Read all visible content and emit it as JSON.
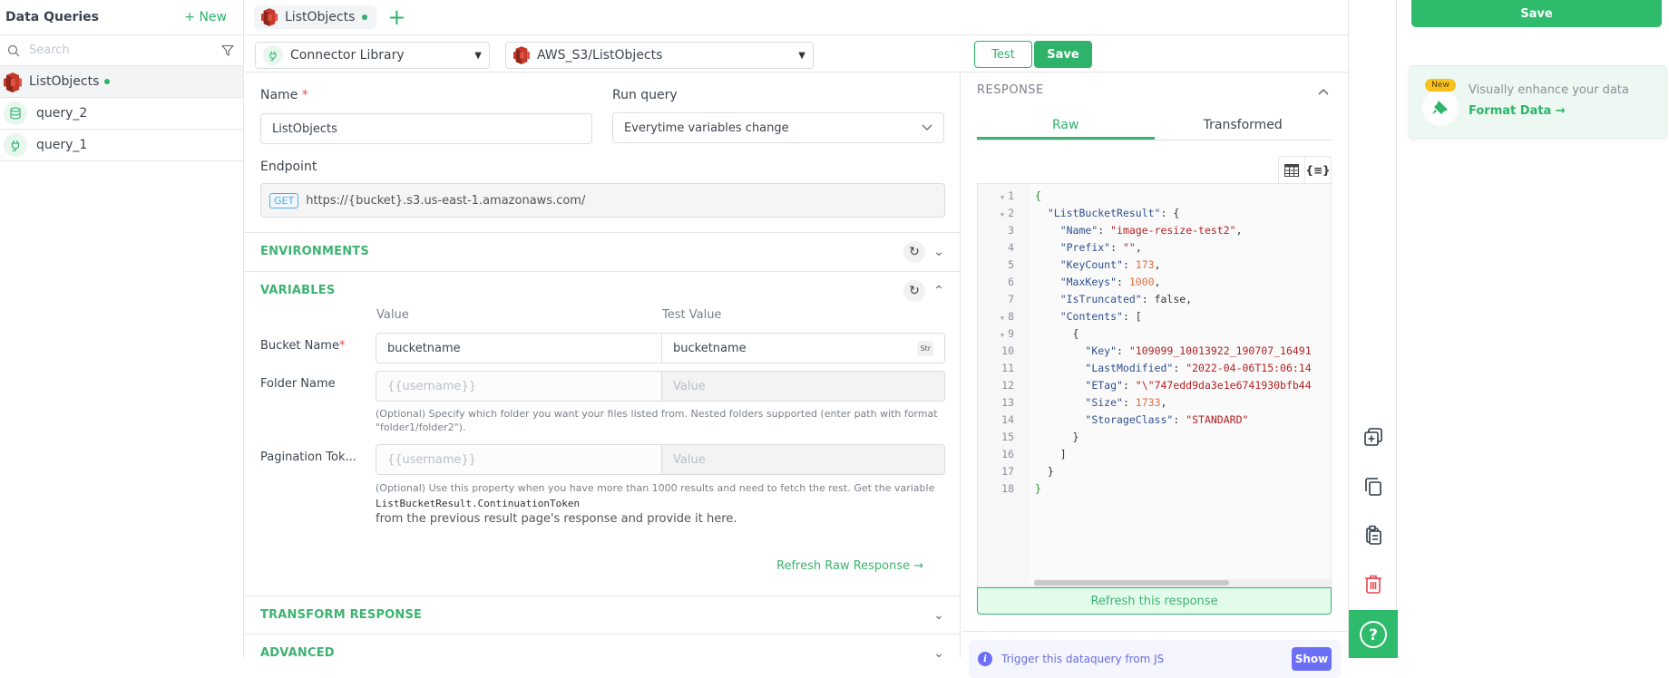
{
  "sidebar": {
    "title": "Data Queries",
    "new_label": "+ New",
    "search_placeholder": "Search",
    "items": [
      {
        "label": "ListObjects",
        "icon": "aws-s3-icon",
        "active": true,
        "unsaved": true
      },
      {
        "label": "query_2",
        "icon": "database-icon",
        "active": false
      },
      {
        "label": "query_1",
        "icon": "plug-icon",
        "active": false
      }
    ]
  },
  "topbar": {
    "tab_label": "ListObjects",
    "add_tab": "+"
  },
  "toolbar": {
    "datasource": "Connector Library",
    "operation": "AWS_S3/ListObjects",
    "test_label": "Test",
    "save_label": "Save"
  },
  "editor": {
    "name_label": "Name",
    "name_required": "*",
    "name_value": "ListObjects",
    "run_query_label": "Run query",
    "run_query_value": "Everytime variables change",
    "endpoint_label": "Endpoint",
    "endpoint_method": "GET",
    "endpoint_url": "https://{bucket}.s3.us-east-1.amazonaws.com/",
    "sections": {
      "environments": "ENVIRONMENTS",
      "variables": "VARIABLES",
      "transform": "TRANSFORM RESPONSE",
      "advanced": "ADVANCED"
    },
    "variables": {
      "col_value": "Value",
      "col_test_value": "Test Value",
      "rows": [
        {
          "label": "Bucket Name",
          "required": "*",
          "value": "bucketname",
          "test_value": "bucketname",
          "type_badge": "Str"
        },
        {
          "label": "Folder Name",
          "value_placeholder": "{{username}}",
          "test_placeholder": "Value",
          "help": "(Optional) Specify which folder you want your files listed from. Nested folders supported (enter path with format \"folder1/folder2\")."
        },
        {
          "label": "Pagination Tok...",
          "value_placeholder": "{{username}}",
          "test_placeholder": "Value",
          "help_1": "(Optional) Use this property when you have more than 1000 results and need to fetch the rest. Get the variable",
          "help_code": "ListBucketResult.ContinuationToken",
          "help_2": "from the previous result page's response and provide it here."
        }
      ],
      "refresh_raw": "Refresh Raw Response →"
    }
  },
  "response": {
    "title": "RESPONSE",
    "tabs": [
      "Raw",
      "Transformed"
    ],
    "active_tab": "Raw",
    "lines": [
      {
        "n": "1",
        "fold": true,
        "ind": 0,
        "parts": [
          [
            "b",
            "{"
          ]
        ]
      },
      {
        "n": "2",
        "fold": true,
        "ind": 1,
        "parts": [
          [
            "k",
            "\"ListBucketResult\""
          ],
          [
            "p",
            ": {"
          ]
        ]
      },
      {
        "n": "3",
        "ind": 2,
        "parts": [
          [
            "k",
            "\"Name\""
          ],
          [
            "p",
            ": "
          ],
          [
            "s",
            "\"image-resize-test2\""
          ],
          [
            "p",
            ","
          ]
        ]
      },
      {
        "n": "4",
        "ind": 2,
        "parts": [
          [
            "k",
            "\"Prefix\""
          ],
          [
            "p",
            ": "
          ],
          [
            "s",
            "\"\""
          ],
          [
            "p",
            ","
          ]
        ]
      },
      {
        "n": "5",
        "ind": 2,
        "parts": [
          [
            "k",
            "\"KeyCount\""
          ],
          [
            "p",
            ": "
          ],
          [
            "n",
            "173"
          ],
          [
            "p",
            ","
          ]
        ]
      },
      {
        "n": "6",
        "ind": 2,
        "parts": [
          [
            "k",
            "\"MaxKeys\""
          ],
          [
            "p",
            ": "
          ],
          [
            "n",
            "1000"
          ],
          [
            "p",
            ","
          ]
        ]
      },
      {
        "n": "7",
        "ind": 2,
        "parts": [
          [
            "k",
            "\"IsTruncated\""
          ],
          [
            "p",
            ": false,"
          ]
        ]
      },
      {
        "n": "8",
        "fold": true,
        "ind": 2,
        "parts": [
          [
            "k",
            "\"Contents\""
          ],
          [
            "p",
            ": ["
          ]
        ]
      },
      {
        "n": "9",
        "fold": true,
        "ind": 3,
        "parts": [
          [
            "p",
            "{"
          ]
        ]
      },
      {
        "n": "10",
        "ind": 4,
        "parts": [
          [
            "k",
            "\"Key\""
          ],
          [
            "p",
            ": "
          ],
          [
            "s",
            "\"109099_10013922_190707_16491"
          ]
        ]
      },
      {
        "n": "11",
        "ind": 4,
        "parts": [
          [
            "k",
            "\"LastModified\""
          ],
          [
            "p",
            ": "
          ],
          [
            "s",
            "\"2022-04-06T15:06:14"
          ]
        ]
      },
      {
        "n": "12",
        "ind": 4,
        "parts": [
          [
            "k",
            "\"ETag\""
          ],
          [
            "p",
            ": "
          ],
          [
            "s",
            "\"\\\"747edd9da3e1e6741930bfb44"
          ]
        ]
      },
      {
        "n": "13",
        "ind": 4,
        "parts": [
          [
            "k",
            "\"Size\""
          ],
          [
            "p",
            ": "
          ],
          [
            "n",
            "1733"
          ],
          [
            "p",
            ","
          ]
        ]
      },
      {
        "n": "14",
        "ind": 4,
        "parts": [
          [
            "k",
            "\"StorageClass\""
          ],
          [
            "p",
            ": "
          ],
          [
            "s",
            "\"STANDARD\""
          ]
        ]
      },
      {
        "n": "15",
        "ind": 3,
        "parts": [
          [
            "p",
            "}"
          ]
        ]
      },
      {
        "n": "16",
        "ind": 2,
        "parts": [
          [
            "p",
            "]"
          ]
        ]
      },
      {
        "n": "17",
        "ind": 1,
        "parts": [
          [
            "p",
            "}"
          ]
        ]
      },
      {
        "n": "18",
        "ind": 0,
        "parts": [
          [
            "b",
            "}"
          ]
        ]
      }
    ],
    "refresh_label": "Refresh this response",
    "trigger_text": "Trigger this dataquery from JS",
    "show_label": "Show"
  },
  "right_panel": {
    "save_label": "Save",
    "promo_badge": "New",
    "promo_text": "Visually enhance your data",
    "promo_link": "Format Data →"
  },
  "colors": {
    "brand": "#2fbb6c",
    "danger": "#e5484d",
    "info": "#6c6ff5"
  }
}
